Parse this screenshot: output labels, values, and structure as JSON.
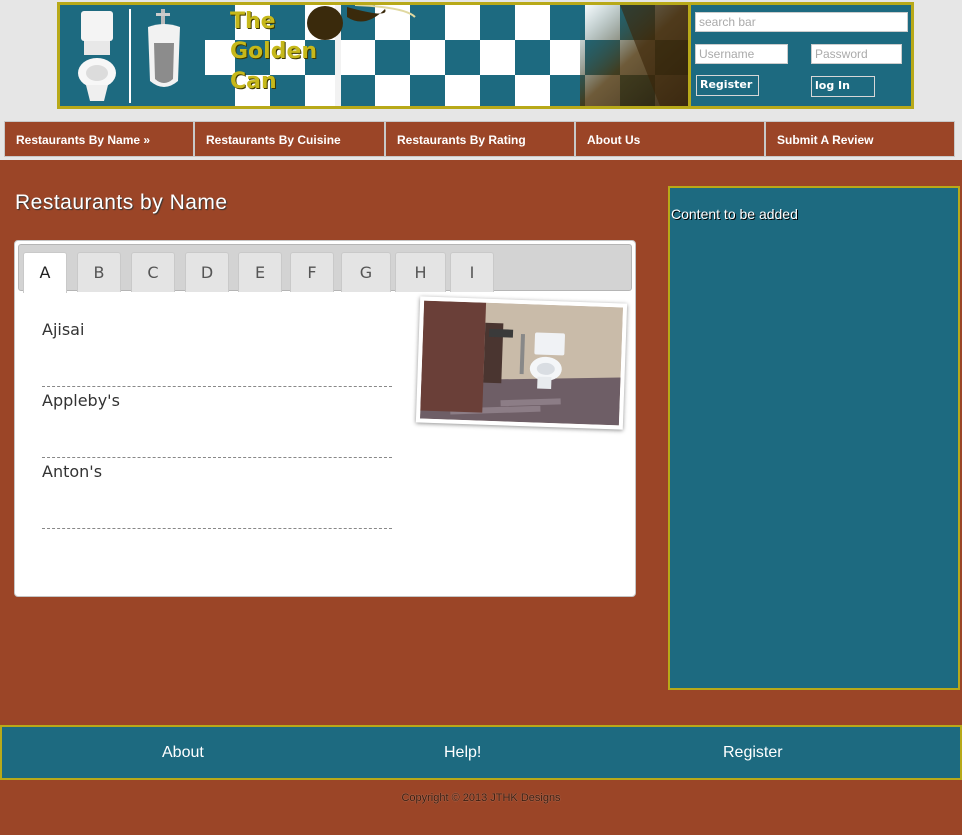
{
  "header": {
    "logo_text": [
      "The",
      "Golden",
      "Can"
    ],
    "search": {
      "placeholder": "search bar"
    },
    "login": {
      "username_placeholder": "Username",
      "password_placeholder": "Password",
      "register_label": "Register",
      "login_label": "log In"
    }
  },
  "nav": {
    "items": [
      {
        "label": "Restaurants By Name »"
      },
      {
        "label": "Restaurants By Cuisine"
      },
      {
        "label": "Restaurants By Rating"
      },
      {
        "label": "About Us"
      },
      {
        "label": "Submit A Review"
      }
    ]
  },
  "main": {
    "title": "Restaurants by Name",
    "tabs": [
      {
        "label": "A",
        "active": true
      },
      {
        "label": "B"
      },
      {
        "label": "C"
      },
      {
        "label": "D"
      },
      {
        "label": "E"
      },
      {
        "label": "F"
      },
      {
        "label": "G"
      },
      {
        "label": "H"
      },
      {
        "label": "I"
      }
    ],
    "restaurants": [
      {
        "name": "Ajisai"
      },
      {
        "name": "Appleby's"
      },
      {
        "name": "Anton's"
      }
    ],
    "photo_icon": "restroom-photo"
  },
  "sidebar": {
    "text": "Content to be added"
  },
  "footer": {
    "links": [
      {
        "label": "About"
      },
      {
        "label": "Help!"
      },
      {
        "label": "Register"
      }
    ],
    "copyright": "Copyright © 2013 JTHK Designs"
  },
  "colors": {
    "brand_teal": "#1d6a80",
    "brand_rust": "#9b4527",
    "brand_gold": "#b8a919"
  }
}
